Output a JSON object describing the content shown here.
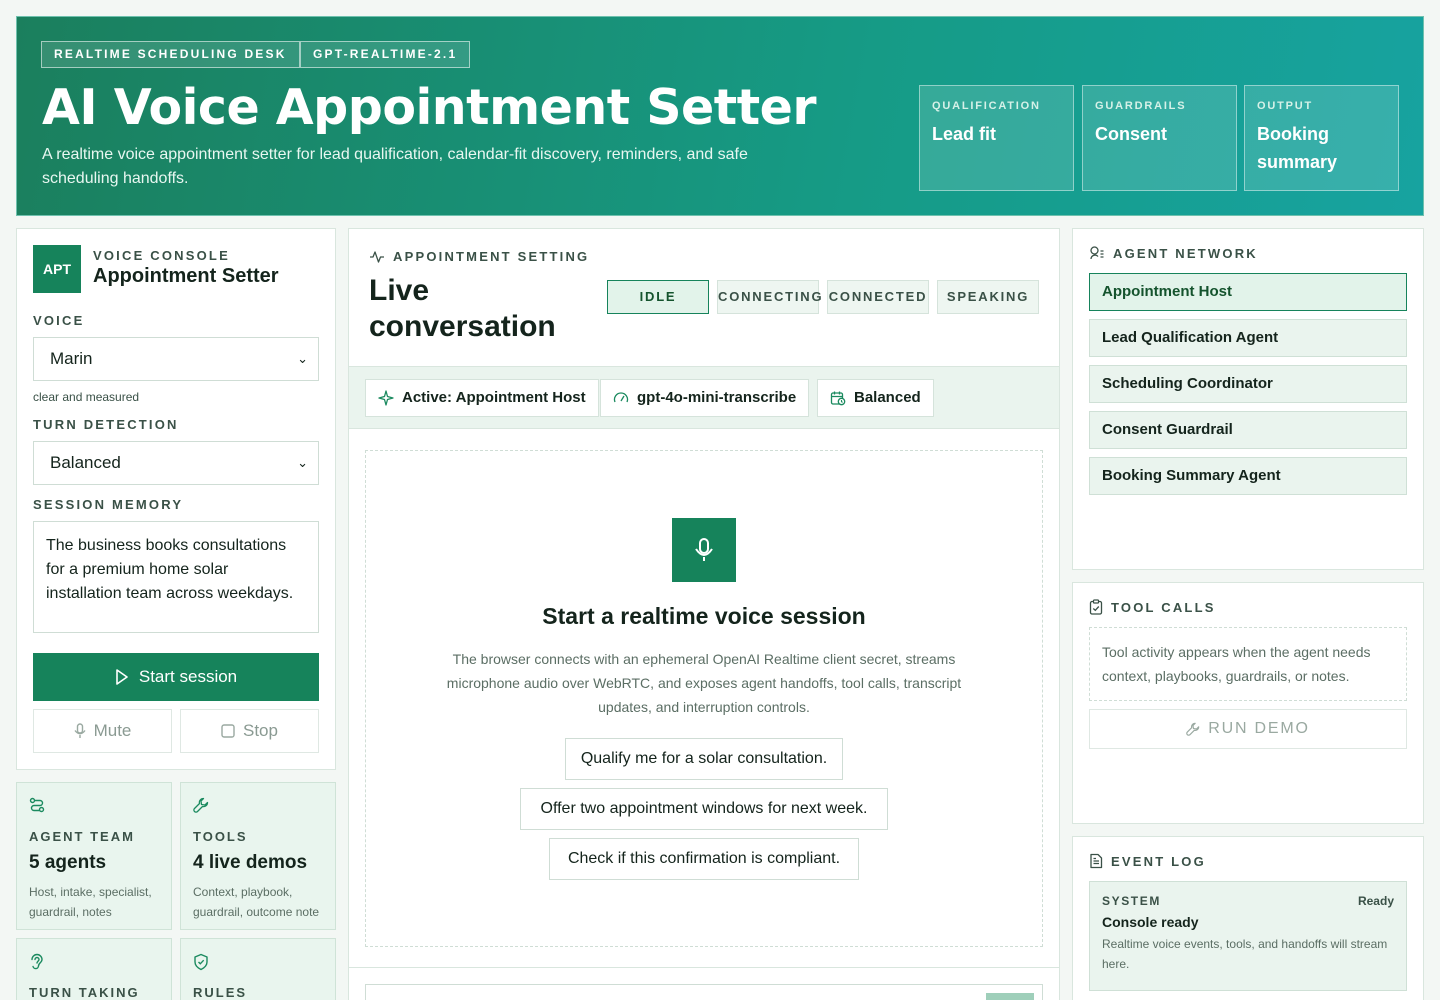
{
  "hero": {
    "chips": [
      "REALTIME SCHEDULING DESK",
      "GPT-REALTIME-2.1"
    ],
    "title": "AI Voice Appointment Setter",
    "description": "A realtime voice appointment setter for lead qualification, calendar-fit discovery, reminders, and safe scheduling handoffs.",
    "stats": [
      {
        "label": "QUALIFICATION",
        "value": "Lead fit"
      },
      {
        "label": "GUARDRAILS",
        "value": "Consent"
      },
      {
        "label": "OUTPUT",
        "value": "Booking summary"
      }
    ]
  },
  "console": {
    "badge": "APT",
    "kicker": "VOICE CONSOLE",
    "title": "Appointment Setter",
    "voice_label": "VOICE",
    "voice_value": "Marin",
    "voice_hint": "clear and measured",
    "turn_label": "TURN DETECTION",
    "turn_value": "Balanced",
    "memory_label": "SESSION MEMORY",
    "memory_value": "The business books consultations for a premium home solar installation team across weekdays.",
    "start_label": "Start session",
    "mute_label": "Mute",
    "stop_label": "Stop"
  },
  "mini_cards": [
    {
      "icon": "route-icon",
      "label": "AGENT TEAM",
      "value": "5 agents",
      "desc": "Host, intake, specialist, guardrail, notes"
    },
    {
      "icon": "wrench-icon",
      "label": "TOOLS",
      "value": "4 live demos",
      "desc": "Context, playbook, guardrail, outcome note"
    },
    {
      "icon": "ear-icon",
      "label": "TURN TAKING",
      "value": "",
      "desc": ""
    },
    {
      "icon": "shield-check-icon",
      "label": "RULES",
      "value": "",
      "desc": ""
    }
  ],
  "conversation": {
    "kicker": "APPOINTMENT SETTING",
    "title_line1": "Live",
    "title_line2": "conversation",
    "statuses": [
      "IDLE",
      "CONNECTING",
      "CONNECTED",
      "SPEAKING"
    ],
    "active_status": "IDLE",
    "pills": [
      "Active: Appointment Host",
      "gpt-4o-mini-transcribe",
      "Balanced"
    ],
    "empty_title": "Start a realtime voice session",
    "empty_desc": "The browser connects with an ephemeral OpenAI Realtime client secret, streams microphone audio over WebRTC, and exposes agent handoffs, tool calls, transcript updates, and interruption controls.",
    "prompts": [
      "Qualify me for a solar consultation.",
      "Offer two appointment windows for next week.",
      "Check if this confirmation is compliant."
    ]
  },
  "agent_network": {
    "kicker": "AGENT NETWORK",
    "agents": [
      "Appointment Host",
      "Lead Qualification Agent",
      "Scheduling Coordinator",
      "Consent Guardrail",
      "Booking Summary Agent"
    ],
    "active": "Appointment Host"
  },
  "tool_calls": {
    "kicker": "TOOL CALLS",
    "empty_text": "Tool activity appears when the agent needs context, playbooks, guardrails, or notes.",
    "demo_label": "RUN DEMO"
  },
  "event_log": {
    "kicker": "EVENT LOG",
    "events": [
      {
        "source": "SYSTEM",
        "status": "Ready",
        "title": "Console ready",
        "body": "Realtime voice events, tools, and handoffs will stream here."
      }
    ]
  },
  "colors": {
    "accent": "#16835b",
    "hero_start": "#1b7f5d",
    "hero_end": "#17a3a0",
    "soft_green": "#e9f5ee"
  }
}
